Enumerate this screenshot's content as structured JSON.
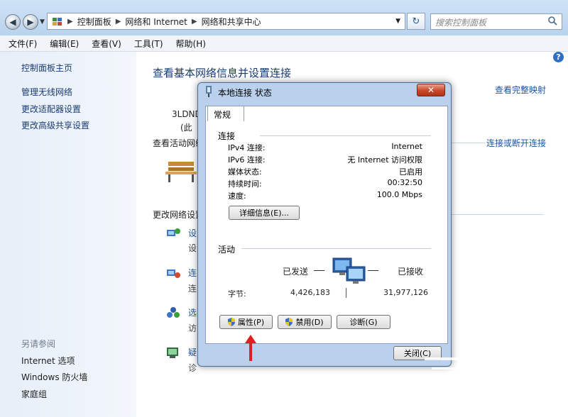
{
  "breadcrumbs": [
    "控制面板",
    "网络和 Internet",
    "网络和共享中心"
  ],
  "search": {
    "placeholder": "搜索控制面板"
  },
  "menu": [
    "文件(F)",
    "编辑(E)",
    "查看(V)",
    "工具(T)",
    "帮助(H)"
  ],
  "left_pane": {
    "home": "控制面板主页",
    "links": [
      "管理无线网络",
      "更改适配器设置",
      "更改高级共享设置"
    ],
    "see_also_title": "另请参阅",
    "see_also": [
      "Internet 选项",
      "Windows 防火墙",
      "家庭组"
    ]
  },
  "main": {
    "title": "查看基本网络信息并设置连接",
    "view_full_map": "查看完整映射",
    "computer_name": "3LDND",
    "computer_suffix": "(此",
    "active_networks": "查看活动网络",
    "connect_disconnect": "连接或断开连接",
    "change_settings": "更改网络设置",
    "tasks_partial": [
      {
        "title": "设",
        "desc": "设"
      },
      {
        "title": "连",
        "desc": "连"
      },
      {
        "title": "选",
        "desc": "访"
      },
      {
        "title": "疑",
        "desc": "诊"
      }
    ]
  },
  "dialog": {
    "title": "本地连接 状态",
    "close": "✕",
    "tab": "常规",
    "connection_group": "连接",
    "rows": [
      {
        "label": "IPv4 连接:",
        "value": "Internet"
      },
      {
        "label": "IPv6 连接:",
        "value": "无 Internet 访问权限"
      },
      {
        "label": "媒体状态:",
        "value": "已启用"
      },
      {
        "label": "持续时间:",
        "value": "00:32:50"
      },
      {
        "label": "速度:",
        "value": "100.0 Mbps"
      }
    ],
    "details_button": "详细信息(E)...",
    "activity_group": "活动",
    "sent_label": "已发送",
    "received_label": "已接收",
    "bytes_label": "字节:",
    "bytes_sent": "4,426,183",
    "bytes_received": "31,977,126",
    "properties_button": "属性(P)",
    "disable_button": "禁用(D)",
    "diagnose_button": "诊断(G)",
    "close_button": "关闭(C)"
  },
  "colors": {
    "link": "#1a55a8",
    "arrow": "#e02020",
    "close_button": "#c9472b"
  }
}
